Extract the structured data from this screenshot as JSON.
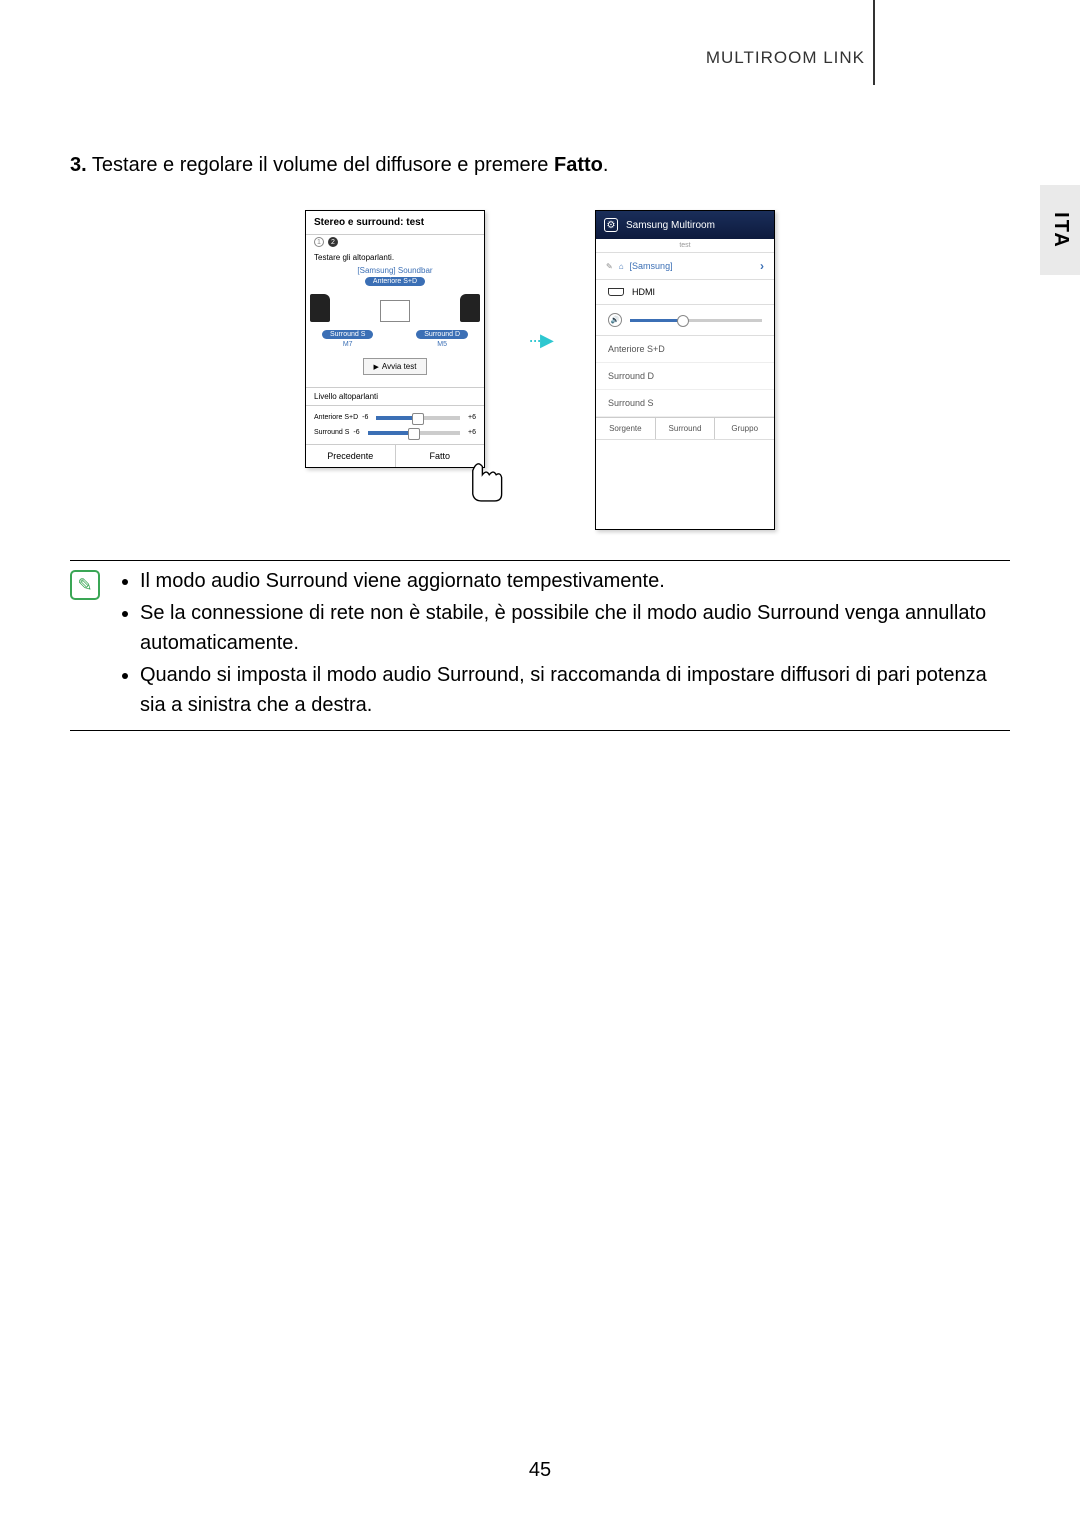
{
  "header": {
    "title": "MULTIROOM LINK"
  },
  "sideTab": "ITA",
  "step": {
    "num": "3.",
    "text_a": "Testare e regolare il volume del diffusore e premere ",
    "bold": "Fatto",
    "text_b": "."
  },
  "phone1": {
    "title": "Stereo e surround: test",
    "subtitle": "Testare gli altoparlanti.",
    "soundbar": "[Samsung] Soundbar",
    "pillFront": "Anteriore S+D",
    "surroundS": "Surround S",
    "surroundD": "Surround D",
    "m7": "M7",
    "m5": "M5",
    "avvia": "Avvia test",
    "levelLabel": "Livello altoparlanti",
    "slider1": {
      "label": "Anteriore S+D",
      "min": "-6",
      "max": "+6"
    },
    "slider2": {
      "label": "Surround S",
      "min": "-6",
      "max": "+6"
    },
    "btnPrev": "Precedente",
    "btnDone": "Fatto"
  },
  "phone2": {
    "title": "Samsung Multiroom",
    "sub": "test",
    "group": "[Samsung]",
    "hdmi": "HDMI",
    "list": [
      "Anteriore S+D",
      "Surround D",
      "Surround S"
    ],
    "tabs": [
      "Sorgente",
      "Surround",
      "Gruppo"
    ]
  },
  "notes": [
    "Il modo audio Surround viene aggiornato tempestivamente.",
    "Se la connessione di rete non è stabile, è possibile che il modo audio Surround venga annullato automaticamente.",
    "Quando si imposta il modo audio Surround, si raccomanda di impostare diffusori di pari potenza sia a sinistra che a destra."
  ],
  "pageNum": "45"
}
